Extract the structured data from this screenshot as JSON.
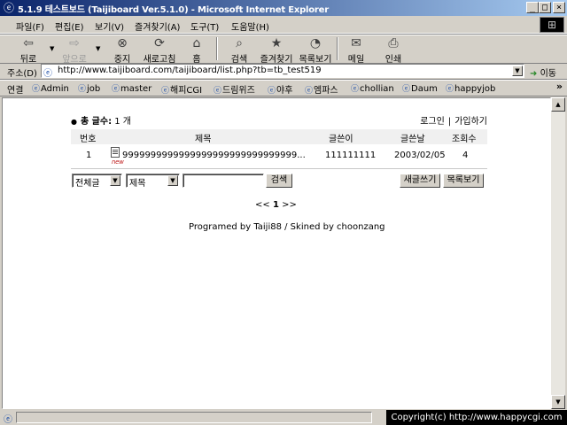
{
  "window": {
    "title": "5.1.9 테스트보드 (Taijiboard Ver.5.1.0) - Microsoft Internet Explorer",
    "buttons": {
      "minimize": "_",
      "maximize": "□",
      "close": "×"
    }
  },
  "menubar": {
    "items": [
      "파일(F)",
      "편집(E)",
      "보기(V)",
      "즐겨찾기(A)",
      "도구(T)",
      "도움말(H)"
    ]
  },
  "toolbar": {
    "buttons": [
      {
        "label": "뒤로",
        "icon": "back-arrow-icon",
        "disabled": false
      },
      {
        "label": "앞으로",
        "icon": "forward-arrow-icon",
        "disabled": true
      },
      {
        "label": "중지",
        "icon": "stop-icon",
        "disabled": false
      },
      {
        "label": "새로고침",
        "icon": "refresh-icon",
        "disabled": false
      },
      {
        "label": "홈",
        "icon": "home-icon",
        "disabled": false
      },
      {
        "label": "검색",
        "icon": "search-icon",
        "disabled": false
      },
      {
        "label": "즐겨찾기",
        "icon": "favorites-icon",
        "disabled": false
      },
      {
        "label": "목록보기",
        "icon": "history-icon",
        "disabled": false
      },
      {
        "label": "메일",
        "icon": "mail-icon",
        "disabled": false
      },
      {
        "label": "인쇄",
        "icon": "print-icon",
        "disabled": false
      }
    ]
  },
  "address": {
    "label": "주소(D)",
    "url": "http://www.taijiboard.com/taijiboard/list.php?tb=tb_test519",
    "go_label": "이동"
  },
  "links": {
    "label": "연결",
    "items": [
      "Admin",
      "job",
      "master",
      "해피CGI",
      "드림위즈",
      "야후",
      "엠파스",
      "chollian",
      "Daum",
      "happyjob"
    ]
  },
  "board": {
    "count_label": "총 글수:",
    "count_value": "1 개",
    "login": "로그인",
    "join": "가입하기",
    "columns": {
      "no": "번호",
      "title": "제목",
      "author": "글쓴이",
      "date": "글쓴날",
      "views": "조회수"
    },
    "rows": [
      {
        "no": "1",
        "title": "9999999999999999999999999999999...",
        "new_badge": "new",
        "author": "111111111",
        "date": "2003/02/05",
        "views": "4"
      }
    ],
    "search": {
      "scope_value": "전체글",
      "field_value": "제목",
      "query": "",
      "search_button": "검색"
    },
    "write_button": "새글쓰기",
    "list_button": "목록보기",
    "pager": {
      "prev": "<<",
      "current": "1",
      "next": ">>"
    },
    "credits": "Programed by Taiji88 / Skined by choonzang"
  },
  "status": {
    "text": "",
    "copyright": "Copyright(c) http://www.happycgi.com"
  }
}
